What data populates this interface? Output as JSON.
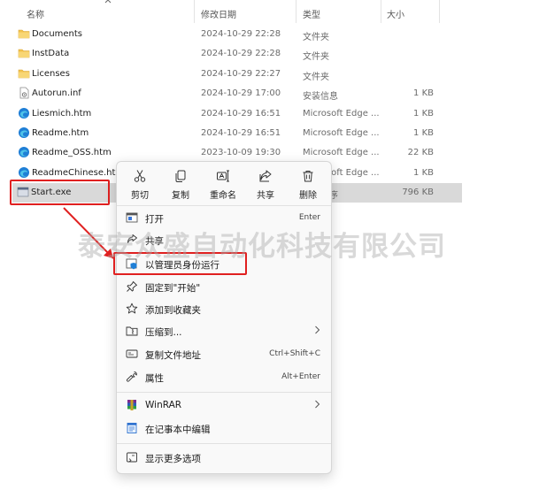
{
  "header": {
    "name": "名称",
    "modified": "修改日期",
    "type": "类型",
    "size": "大小"
  },
  "files": [
    {
      "name": "Documents",
      "date": "2024-10-29 22:28",
      "type": "文件夹",
      "size": "",
      "icon": "folder-icon"
    },
    {
      "name": "InstData",
      "date": "2024-10-29 22:28",
      "type": "文件夹",
      "size": "",
      "icon": "folder-icon"
    },
    {
      "name": "Licenses",
      "date": "2024-10-29 22:27",
      "type": "文件夹",
      "size": "",
      "icon": "folder-icon"
    },
    {
      "name": "Autorun.inf",
      "date": "2024-10-29 17:00",
      "type": "安装信息",
      "size": "1 KB",
      "icon": "setup-info-icon"
    },
    {
      "name": "Liesmich.htm",
      "date": "2024-10-29 16:51",
      "type": "Microsoft Edge ...",
      "size": "1 KB",
      "icon": "edge-icon"
    },
    {
      "name": "Readme.htm",
      "date": "2024-10-29 16:51",
      "type": "Microsoft Edge ...",
      "size": "1 KB",
      "icon": "edge-icon"
    },
    {
      "name": "Readme_OSS.htm",
      "date": "2023-10-09 19:30",
      "type": "Microsoft Edge ...",
      "size": "22 KB",
      "icon": "edge-icon"
    },
    {
      "name": "ReadmeChinese.htm",
      "date": "",
      "type": "Microsoft Edge ...",
      "size": "1 KB",
      "icon": "edge-icon"
    },
    {
      "name": "Start.exe",
      "date": "",
      "type": "序",
      "size": "796 KB",
      "icon": "exe-icon",
      "selected": true
    }
  ],
  "quick_actions": [
    {
      "label": "剪切",
      "icon": "scissors-icon"
    },
    {
      "label": "复制",
      "icon": "copy-icon"
    },
    {
      "label": "重命名",
      "icon": "rename-icon"
    },
    {
      "label": "共享",
      "icon": "share-icon"
    },
    {
      "label": "删除",
      "icon": "trash-icon"
    }
  ],
  "menu": {
    "open": {
      "label": "打开",
      "shortcut": "Enter"
    },
    "share": {
      "label": "共享"
    },
    "run_as_admin": {
      "label": "以管理员身份运行"
    },
    "pin_start": {
      "label": "固定到\"开始\""
    },
    "add_favorites": {
      "label": "添加到收藏夹"
    },
    "compress": {
      "label": "压缩到..."
    },
    "copy_path": {
      "label": "复制文件地址",
      "shortcut": "Ctrl+Shift+C"
    },
    "properties": {
      "label": "属性",
      "shortcut": "Alt+Enter"
    },
    "winrar": {
      "label": "WinRAR"
    },
    "notepad": {
      "label": "在记事本中编辑"
    },
    "more_options": {
      "label": "显示更多选项"
    }
  },
  "watermark": "泰安众盛自动化科技有限公司",
  "colors": {
    "highlight_red": "#e02020",
    "folder_yellow": "#f3c24f",
    "edge_blue": "#1f7fd6",
    "selection_gray": "#d9d9d9"
  }
}
